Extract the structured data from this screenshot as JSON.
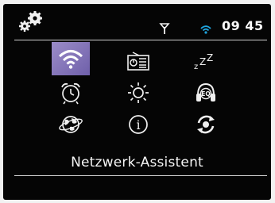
{
  "status_bar": {
    "time": "09 45",
    "settings_icon": "settings-gears-icon",
    "antenna_icon": "antenna-signal-icon",
    "wifi_icon": "wifi-status-icon"
  },
  "menu": {
    "selected_label": "Netzwerk-Assistent",
    "items": [
      {
        "icon": "wifi-icon",
        "selected": true
      },
      {
        "icon": "radio-tuner-icon"
      },
      {
        "icon": "sleep-timer-icon",
        "text": "zZZ"
      },
      {
        "icon": "alarm-clock-icon"
      },
      {
        "icon": "brightness-icon"
      },
      {
        "icon": "equalizer-headphones-icon",
        "text": "EQ"
      },
      {
        "icon": "globe-world-icon"
      },
      {
        "icon": "info-icon",
        "text": "i"
      },
      {
        "icon": "update-sync-icon"
      }
    ]
  },
  "colors": {
    "screen": "#050505",
    "selected_tile": "#7d6eb6",
    "accent_wifi": "#1fa3dd"
  }
}
